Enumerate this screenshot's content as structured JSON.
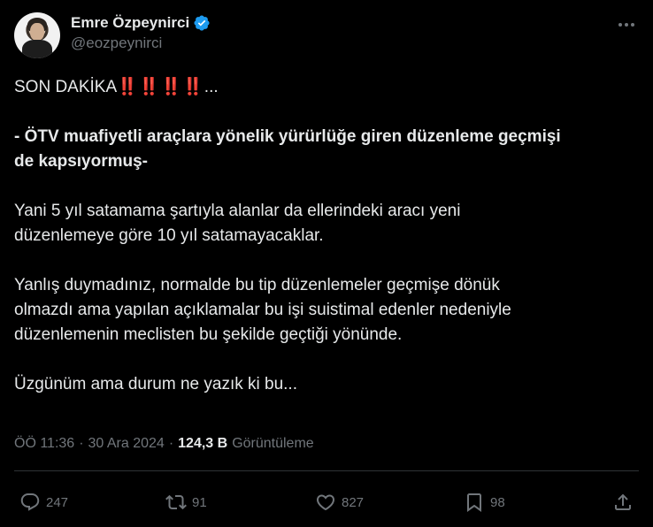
{
  "author": {
    "display_name": "Emre Özpeynirci",
    "handle": "@eozpeynirci",
    "verified": true
  },
  "tweet": {
    "line1_text": "SON DAKİKA",
    "line1_bangs": "‼️‼️‼️‼️",
    "line1_tail": "...",
    "bold_line1": "- ÖTV muafiyetli araçlara yönelik yürürlüğe giren düzenleme geçmişi",
    "bold_line2": "de kapsıyormuş-",
    "para2_line1": "Yani 5 yıl satamama şartıyla alanlar da ellerindeki aracı yeni",
    "para2_line2": "düzenlemeye göre 10 yıl satamayacaklar.",
    "para3_line1": "Yanlış duymadınız, normalde bu tip düzenlemeler geçmişe dönük",
    "para3_line2": "olmazdı ama yapılan açıklamalar bu işi suistimal edenler nedeniyle",
    "para3_line3": "düzenlemenin meclisten bu şekilde geçtiği yönünde.",
    "para4_line1": "Üzgünüm ama durum ne yazık ki bu..."
  },
  "meta": {
    "time": "ÖÖ 11:36",
    "separator": "·",
    "date": "30 Ara 2024",
    "views_count": "124,3 B",
    "views_label": "Görüntüleme"
  },
  "actions": {
    "replies": "247",
    "retweets": "91",
    "likes": "827",
    "bookmarks": "98"
  },
  "colors": {
    "background": "#000000",
    "text": "#e7e9ea",
    "muted": "#71767b",
    "verified": "#1d9bf0",
    "divider": "#2f3336"
  }
}
